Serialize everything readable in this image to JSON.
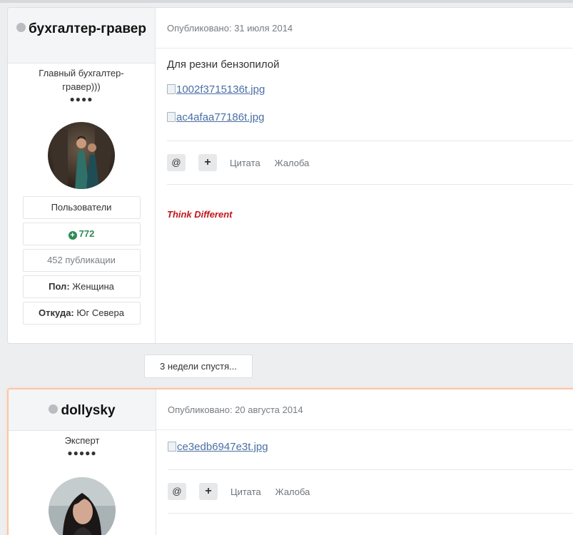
{
  "posts": [
    {
      "author": {
        "name": "бухгалтер-гравер",
        "title": "Главный бухгалтер-гравер)))",
        "rank_dots": "●●●●",
        "group": "Пользователи",
        "reputation": "772",
        "posts_count": "452 публикации",
        "gender_label": "Пол:",
        "gender_value": "Женщина",
        "location_label": "Откуда:",
        "location_value": "Юг Севера"
      },
      "published": "Опубликовано: 31 июля 2014",
      "text": "Для резни бензопилой",
      "images": [
        "1002f3715136t.jpg",
        "ac4afaa77186t.jpg"
      ],
      "actions": {
        "mention": "@",
        "multiquote": "+",
        "quote": "Цитата",
        "report": "Жалоба"
      },
      "signature": "Think Different"
    },
    {
      "author": {
        "name": "dollysky",
        "title": "Эксперт",
        "rank_dots": "●●●●●"
      },
      "published": "Опубликовано: 20 августа 2014",
      "images": [
        "ce3edb6947e3t.jpg"
      ],
      "actions": {
        "mention": "@",
        "multiquote": "+",
        "quote": "Цитата",
        "report": "Жалоба"
      }
    }
  ],
  "gap_label": "3 недели спустя...",
  "colors": {
    "reputation": "#2f8a55",
    "signature": "#c0171b",
    "highlight_border": "#f2c7ae"
  }
}
